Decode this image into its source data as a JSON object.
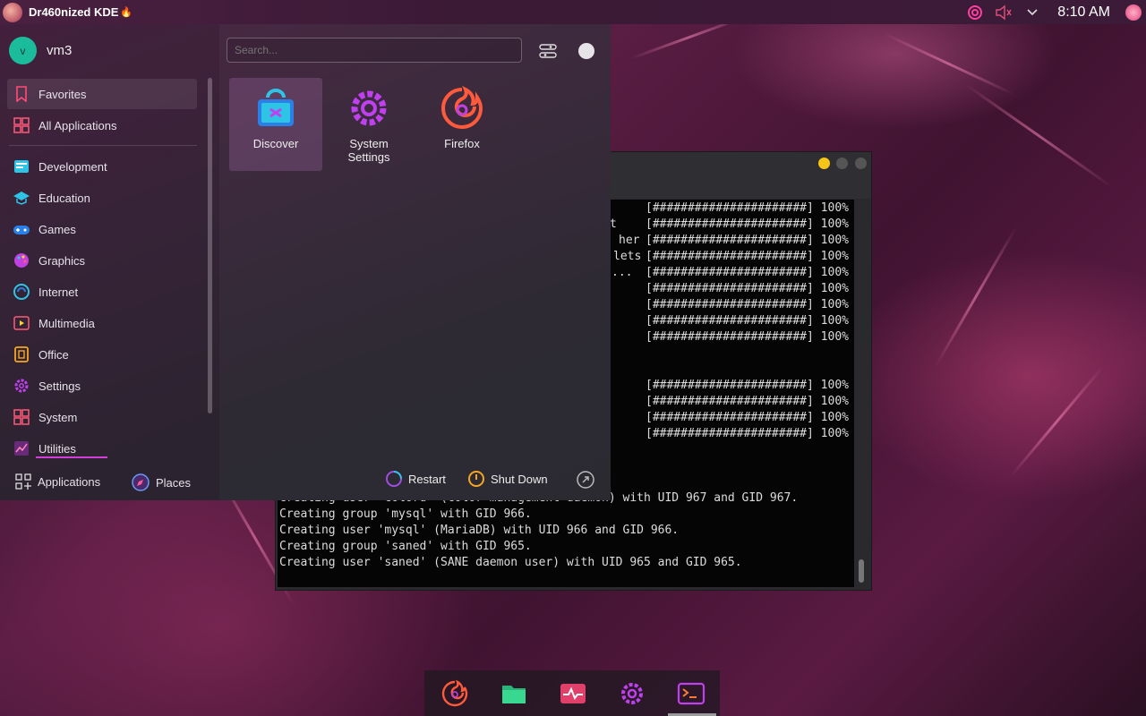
{
  "top_panel": {
    "title": "Dr460nized KDE",
    "title_suffix_icon": "fire-icon",
    "clock": "8:10 AM",
    "tray_icons": [
      "garuda-icon",
      "volume-muted-icon",
      "chevron-down-icon"
    ]
  },
  "launcher": {
    "user": {
      "initial": "v",
      "name": "vm3"
    },
    "search": {
      "placeholder": "Search..."
    },
    "categories": [
      {
        "label": "Favorites",
        "icon": "bookmark-icon"
      },
      {
        "label": "All Applications",
        "icon": "grid-icon"
      },
      {
        "label": "Development",
        "icon": "development-icon"
      },
      {
        "label": "Education",
        "icon": "graduation-cap-icon"
      },
      {
        "label": "Games",
        "icon": "gamepad-icon"
      },
      {
        "label": "Graphics",
        "icon": "palette-icon"
      },
      {
        "label": "Internet",
        "icon": "globe-icon"
      },
      {
        "label": "Multimedia",
        "icon": "multimedia-icon"
      },
      {
        "label": "Office",
        "icon": "office-icon"
      },
      {
        "label": "Settings",
        "icon": "gear-icon"
      },
      {
        "label": "System",
        "icon": "system-icon"
      },
      {
        "label": "Utilities",
        "icon": "utilities-icon"
      }
    ],
    "apps": [
      {
        "label": "Discover",
        "icon": "discover-icon"
      },
      {
        "label": "System\nSettings",
        "icon": "system-settings-icon"
      },
      {
        "label": "Firefox",
        "icon": "firefox-icon"
      }
    ],
    "bottom_tabs": {
      "applications": "Applications",
      "places": "Places"
    },
    "power": {
      "restart": "Restart",
      "shutdown": "Shut Down"
    }
  },
  "terminal": {
    "progress_lines": [
      "[######################] 100%",
      "[######################] 100%",
      "[######################] 100%",
      "[######################] 100%",
      "[######################] 100%",
      "[######################] 100%",
      "[######################] 100%",
      "[######################] 100%",
      "[######################] 100%",
      "[######################] 100%",
      "[######################] 100%",
      "[######################] 100%",
      "[######################] 100%"
    ],
    "partial_names": [
      "t",
      "her",
      "lets",
      "..."
    ],
    "log_lines": [
      "Creating user 'colord' (color management daemon) with UID 967 and GID 967.",
      "Creating group 'mysql' with GID 966.",
      "Creating user 'mysql' (MariaDB) with UID 966 and GID 966.",
      "Creating group 'saned' with GID 965.",
      "Creating user 'saned' (SANE daemon user) with UID 965 and GID 965."
    ]
  },
  "dock": {
    "items": [
      "firefox-icon",
      "file-manager-icon",
      "system-monitor-icon",
      "settings-icon",
      "terminal-icon"
    ]
  },
  "colors": {
    "accent": "#d23fd8",
    "cyan": "#2ec4e6"
  }
}
